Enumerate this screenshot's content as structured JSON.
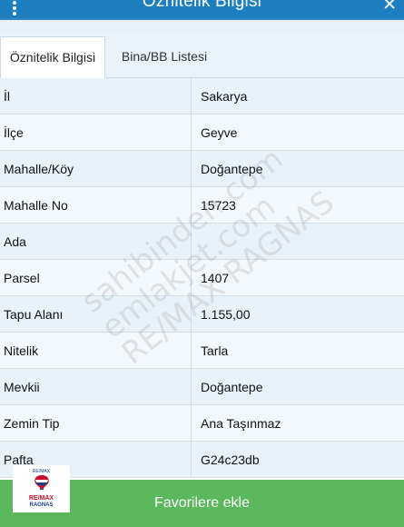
{
  "header": {
    "title": "Öznitelik Bilgisi"
  },
  "tabs": [
    {
      "label": "Öznitelik Bilgisi",
      "active": true
    },
    {
      "label": "Bina/BB Listesi",
      "active": false
    }
  ],
  "rows": [
    {
      "label": "İl",
      "value": "Sakarya"
    },
    {
      "label": "İlçe",
      "value": "Geyve"
    },
    {
      "label": "Mahalle/Köy",
      "value": "Doğantepe"
    },
    {
      "label": "Mahalle No",
      "value": "15723"
    },
    {
      "label": "Ada",
      "value": ""
    },
    {
      "label": "Parsel",
      "value": "1407"
    },
    {
      "label": "Tapu Alanı",
      "value": "1.155,00"
    },
    {
      "label": "Nitelik",
      "value": "Tarla"
    },
    {
      "label": "Mevkii",
      "value": "Doğantepe"
    },
    {
      "label": "Zemin Tip",
      "value": "Ana Taşınmaz"
    },
    {
      "label": "Pafta",
      "value": "G24c23db"
    }
  ],
  "footer": {
    "button_label": "Favorilere ekle"
  },
  "logo": {
    "top_text": "RE/MAX",
    "line1": "RE/MAX",
    "line2": "RAGNAS"
  },
  "watermark": {
    "line1": "sahibinden.com",
    "line2": "emlakjet.com",
    "line3": "RE/MAX RAGNAS"
  },
  "icons": {
    "menu": "vertical-dots-icon",
    "close": "close-icon"
  },
  "colors": {
    "header": "#1e7fc0",
    "row": "#e9f2f9",
    "button": "#5cb85c"
  }
}
